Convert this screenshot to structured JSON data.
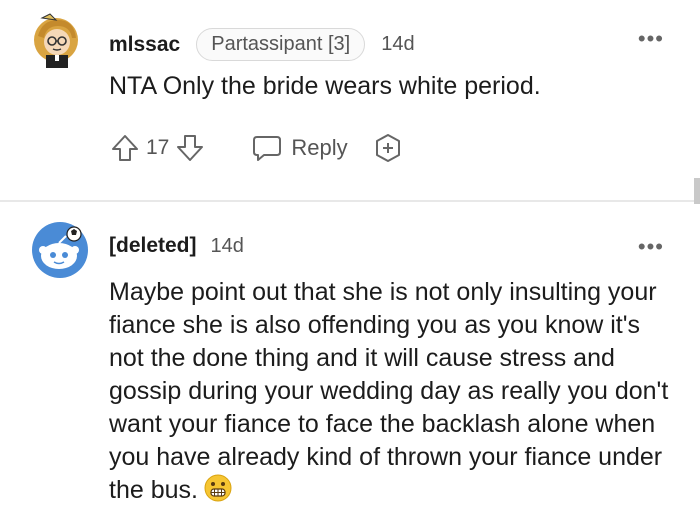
{
  "comments": [
    {
      "username": "mlssac",
      "flair": "Partassipant [3]",
      "age": "14d",
      "text": "NTA Only the bride wears white period.",
      "score": "17",
      "reply_label": "Reply",
      "more": "•••"
    },
    {
      "username": "[deleted]",
      "age": "14d",
      "text": "Maybe point out that she is not only insulting your fiance she is also offending you as you know it's not the done thing and it will cause stress and gossip during your wedding day as really you don't want your fiance to face the backlash alone when you have already kind of thrown your fiance under the bus.",
      "more": "•••"
    }
  ],
  "colors": {
    "text": "#1c1c1c",
    "meta": "#555555",
    "divider": "#e8e8e8",
    "deleted_avatar_bg": "#4a8bd6"
  },
  "icons": [
    "upvote-icon",
    "downvote-icon",
    "reply-bubble-icon",
    "award-plus-icon",
    "grimace-emoji-icon",
    "overflow-menu-icon"
  ]
}
